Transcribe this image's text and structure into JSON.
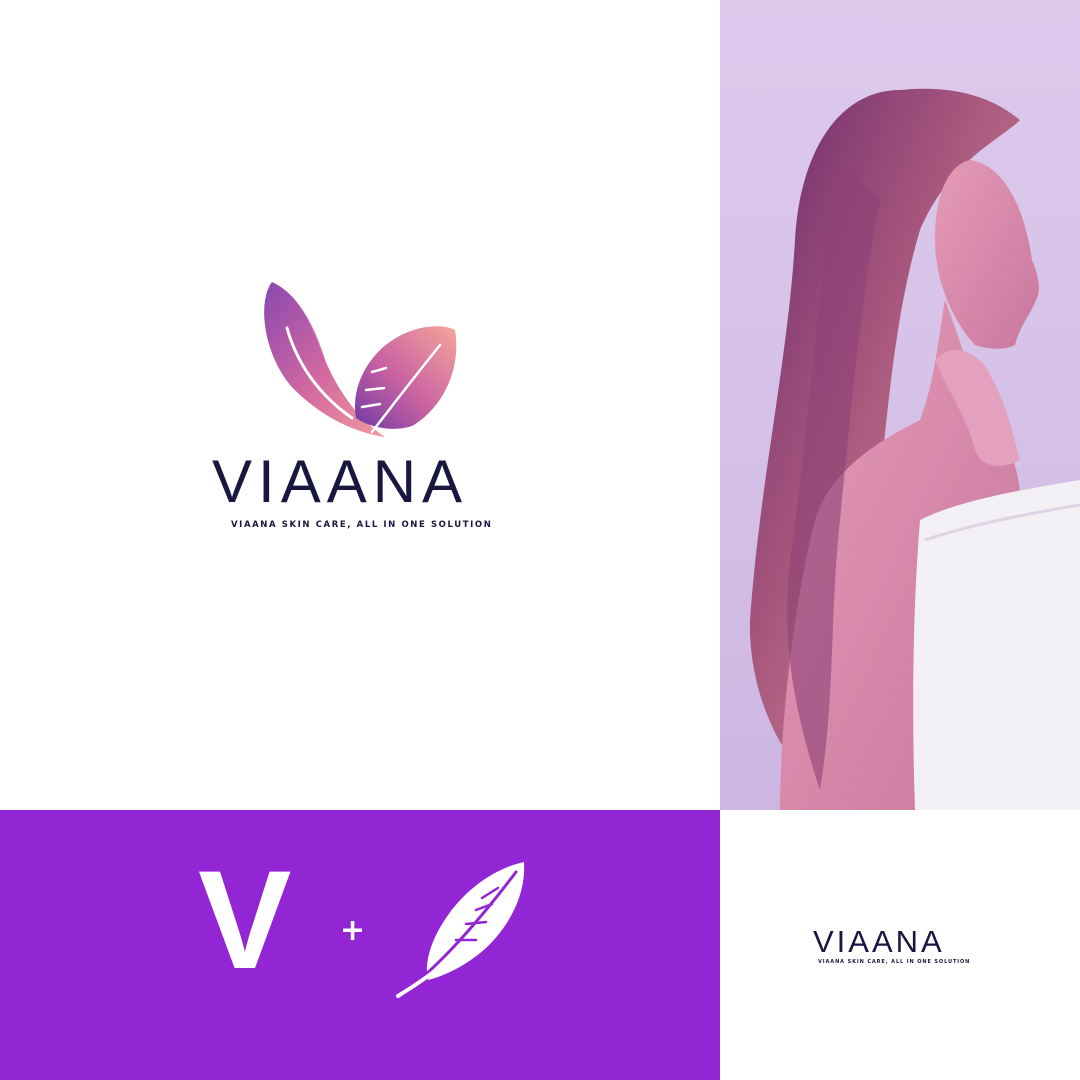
{
  "brand": {
    "name": "VIAANA",
    "tagline": "VIAANA SKIN CARE, ALL IN ONE SOLUTION"
  },
  "concept": {
    "letter": "V",
    "operator": "+",
    "symbol": "feather-icon"
  },
  "colors": {
    "brand_purple": "#9326d4",
    "navy": "#17173f",
    "gradient_purple": "#8a47b0",
    "gradient_pink": "#f29a9b",
    "photo_background": "#d8c6ea",
    "white": "#ffffff"
  },
  "photo": {
    "subject": "woman in white towel touching her chin, purple toned"
  }
}
